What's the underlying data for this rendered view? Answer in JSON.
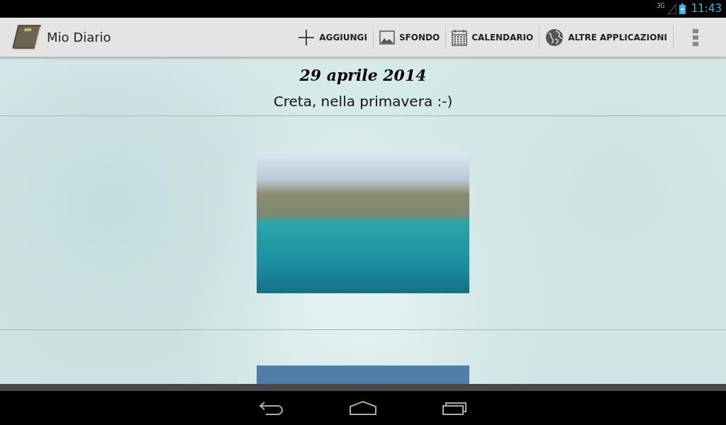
{
  "status_bar": {
    "network": "3G",
    "time": "11:43"
  },
  "action_bar": {
    "title": "Mio Diario",
    "actions": [
      {
        "kind": "add",
        "label": "AGGIUNGI"
      },
      {
        "kind": "background",
        "label": "SFONDO"
      },
      {
        "kind": "calendar",
        "label": "CALENDARIO"
      },
      {
        "kind": "apps",
        "label": "ALTRE APPLICAZIONI"
      }
    ]
  },
  "entry": {
    "date": "29 aprile 2014",
    "caption": "Creta, nella primavera :-)"
  }
}
